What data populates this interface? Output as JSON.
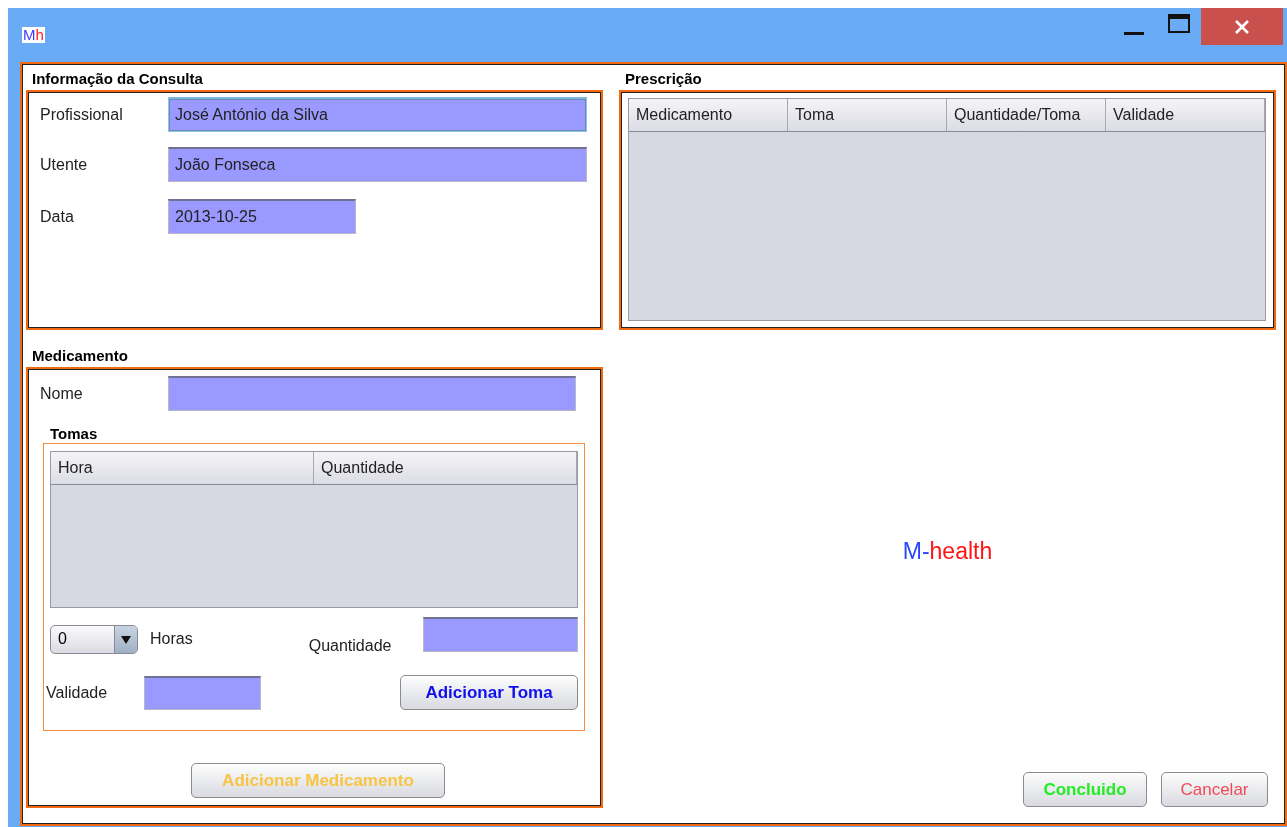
{
  "window": {
    "logo": [
      {
        "text": "M",
        "color": "#3b3bff"
      },
      {
        "text": "h",
        "color": "#ff2020"
      }
    ]
  },
  "consulta": {
    "title": "Informação da Consulta",
    "fields": [
      {
        "label": "Profissional",
        "value": "José António da Silva",
        "focused": true,
        "kind": "text"
      },
      {
        "label": "Utente",
        "value": "João Fonseca",
        "focused": false,
        "kind": "text"
      },
      {
        "label": "Data",
        "value": "2013-10-25",
        "focused": false,
        "kind": "date"
      }
    ]
  },
  "prescricao": {
    "title": "Prescrição",
    "columns": [
      "Medicamento",
      "Toma",
      "Quantidade/Toma",
      "Validade"
    ]
  },
  "medicamento": {
    "title": "Medicamento",
    "name_label": "Nome",
    "tomas": {
      "title": "Tomas",
      "columns": [
        "Hora",
        "Quantidade"
      ],
      "hour_select": "0",
      "hours_label": "Horas",
      "quantity_label": "Quantidade",
      "validity_label": "Validade",
      "add_button": {
        "label": "Adicionar Toma",
        "color": "#1010ee"
      }
    },
    "add_button": {
      "label": "Adicionar Medicamento",
      "color": "#f7c444"
    }
  },
  "brand": [
    {
      "text": "M-",
      "color": "#2848ff"
    },
    {
      "text": "health",
      "color": "#ff1414"
    }
  ],
  "actions": [
    {
      "label": "Concluido",
      "color": "#22ee22"
    },
    {
      "label": "Cancelar",
      "color": "#f04a58"
    }
  ]
}
